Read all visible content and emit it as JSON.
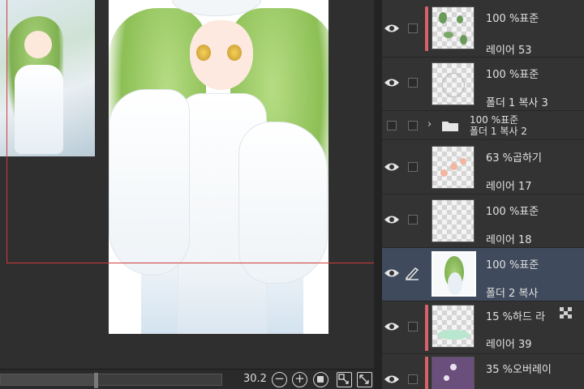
{
  "statusbar": {
    "zoom_value": "30.2",
    "zoom_slider_fraction": 0.43,
    "icons": [
      "zoom-out-icon",
      "zoom-in-icon",
      "stop-icon",
      "fit-to-window-icon",
      "fullscreen-icon"
    ]
  },
  "colors": {
    "guide_line": "#d23a3a",
    "layer_color_label": "#d9616a",
    "selected_row": "#3f4a5c",
    "panel_bg": "#2e2e2e"
  },
  "layers": [
    {
      "mode": "100 %표준",
      "name": "레이어 53",
      "visible": true,
      "color_label": true,
      "type": "layer"
    },
    {
      "mode": "100 %표준",
      "name": "폴더 1 복사 3",
      "visible": true,
      "color_label": false,
      "type": "layer"
    },
    {
      "mode": "100 %표준",
      "name": "폴더 1 복사 2",
      "visible": false,
      "color_label": false,
      "type": "folder"
    },
    {
      "mode": "63 %곱하기",
      "name": "레이어 17",
      "visible": true,
      "color_label": false,
      "type": "layer"
    },
    {
      "mode": "100 %표준",
      "name": "레이어 18",
      "visible": true,
      "color_label": false,
      "type": "layer"
    },
    {
      "mode": "100 %표준",
      "name": "폴더 2 복사",
      "visible": true,
      "color_label": false,
      "type": "layer",
      "selected": true
    },
    {
      "mode": "15 %하드 라",
      "name": "레이어 39",
      "visible": true,
      "color_label": true,
      "type": "layer",
      "has_mask": true
    },
    {
      "mode": "35 %오버레이",
      "name": "",
      "visible": true,
      "color_label": true,
      "type": "layer"
    }
  ]
}
